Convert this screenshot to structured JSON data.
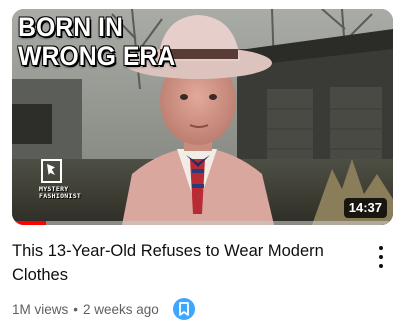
{
  "thumbnail": {
    "overlay_line1": "BORN IN",
    "overlay_line2": "WRONG ERA",
    "channel_logo_line1": "MYSTERY",
    "channel_logo_line2": "FASHIONIST",
    "duration": "14:37",
    "watched_fraction": 0.09,
    "progress_color": "#ff0000"
  },
  "video": {
    "title": "This 13-Year-Old Refuses to Wear Modern Clothes",
    "views": "1M views",
    "separator": "•",
    "age": "2 weeks ago"
  },
  "icons": {
    "save": "bookmark-icon",
    "menu": "more-vert-icon"
  },
  "colors": {
    "save_button": "#3ea6ff",
    "title_text": "#0f0f0f",
    "meta_text": "#606060"
  }
}
